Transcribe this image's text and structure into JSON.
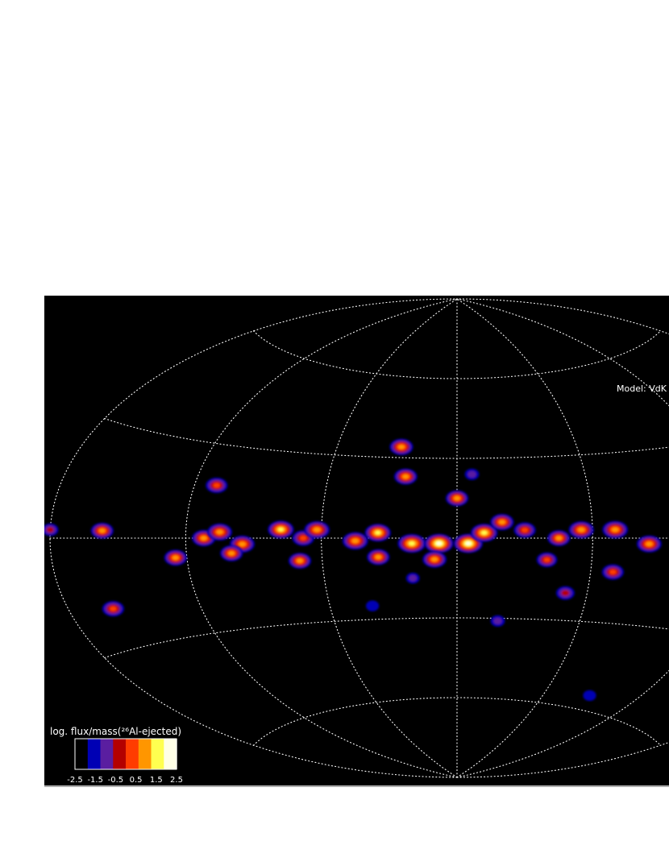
{
  "map": {
    "projection": "aitoff",
    "background": "#000000",
    "grid_color": "#ffffff",
    "grid_style": "dotted",
    "model_label": "Model: VdK",
    "colorbar": {
      "title": "log. flux/mass(²⁶Al-ejected)",
      "ticks": [
        "-2.5",
        "-1.5",
        "-0.5",
        "0.5",
        "1.5",
        "2.5"
      ],
      "colors": [
        "#000000",
        "#0000b4",
        "#5a1ea0",
        "#b40000",
        "#ff3c00",
        "#ff9600",
        "#ffff50",
        "#ffffe6"
      ]
    },
    "emission_blobs": [
      {
        "lon": -28,
        "lat": 34,
        "flux": 1.2
      },
      {
        "lon": -24,
        "lat": 23,
        "flux": 1.1
      },
      {
        "lon": 7,
        "lat": 24,
        "flux": -1.0
      },
      {
        "lon": 0,
        "lat": 15,
        "flux": 1.0
      },
      {
        "lon": -110,
        "lat": 17,
        "flux": 0.8
      },
      {
        "lon": -180,
        "lat": 2,
        "flux": -0.5
      },
      {
        "lon": -157,
        "lat": 2,
        "flux": 1.0
      },
      {
        "lon": -112,
        "lat": 0,
        "flux": 1.2
      },
      {
        "lon": -105,
        "lat": 2,
        "flux": 1.5
      },
      {
        "lon": -95,
        "lat": -2,
        "flux": 1.5
      },
      {
        "lon": -78,
        "lat": 3,
        "flux": 1.8
      },
      {
        "lon": -68,
        "lat": 0,
        "flux": 0.8
      },
      {
        "lon": -62,
        "lat": 3,
        "flux": 1.6
      },
      {
        "lon": -45,
        "lat": -1,
        "flux": 1.7
      },
      {
        "lon": -35,
        "lat": 2,
        "flux": 1.8
      },
      {
        "lon": -20,
        "lat": -2,
        "flux": 2.3
      },
      {
        "lon": -8,
        "lat": -2,
        "flux": 2.5
      },
      {
        "lon": 5,
        "lat": -2,
        "flux": 2.5
      },
      {
        "lon": 12,
        "lat": 2,
        "flux": 2.0
      },
      {
        "lon": 20,
        "lat": 6,
        "flux": 1.2
      },
      {
        "lon": 30,
        "lat": 3,
        "flux": 0.8
      },
      {
        "lon": 45,
        "lat": 0,
        "flux": 1.0
      },
      {
        "lon": 55,
        "lat": 3,
        "flux": 1.6
      },
      {
        "lon": 70,
        "lat": 3,
        "flux": 1.7
      },
      {
        "lon": 85,
        "lat": -2,
        "flux": 1.5
      },
      {
        "lon": 100,
        "lat": 2,
        "flux": 1.4
      },
      {
        "lon": 115,
        "lat": 2,
        "flux": 1.2
      },
      {
        "lon": 130,
        "lat": 2,
        "flux": 1.2
      },
      {
        "lon": -125,
        "lat": -6,
        "flux": 1.0
      },
      {
        "lon": -100,
        "lat": -5,
        "flux": 1.0
      },
      {
        "lon": -70,
        "lat": -8,
        "flux": 1.0
      },
      {
        "lon": -35,
        "lat": -7,
        "flux": 1.0
      },
      {
        "lon": -10,
        "lat": -8,
        "flux": 1.3
      },
      {
        "lon": 40,
        "lat": -8,
        "flux": 0.5
      },
      {
        "lon": 70,
        "lat": -12,
        "flux": 0.8
      },
      {
        "lon": -160,
        "lat": -19,
        "flux": 0.8
      },
      {
        "lon": -20,
        "lat": -15,
        "flux": -1.2
      },
      {
        "lon": 50,
        "lat": -20,
        "flux": 0.0
      },
      {
        "lon": -40,
        "lat": -25,
        "flux": -1.3
      },
      {
        "lon": 20,
        "lat": -31,
        "flux": -1.0
      },
      {
        "lon": 90,
        "lat": -55,
        "flux": -1.3
      }
    ]
  }
}
